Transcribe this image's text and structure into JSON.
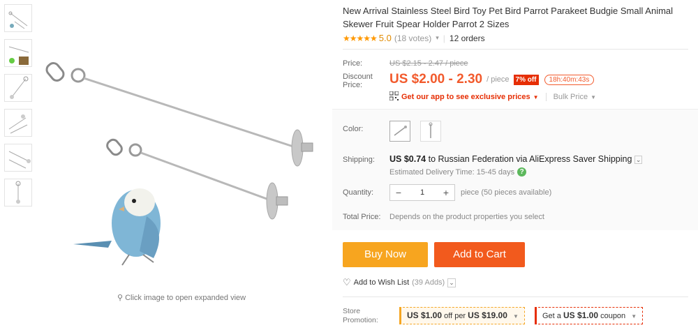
{
  "product": {
    "title": "New Arrival Stainless Steel Bird Toy Pet Bird Parrot Parakeet Budgie Small Animal Skewer Fruit Spear Holder Parrot 2 Sizes"
  },
  "rating": {
    "stars": "★★★★★",
    "score": "5.0",
    "votes": "(18 votes)",
    "orders": "12 orders"
  },
  "gallery": {
    "expand_text": "Click image to open expanded view"
  },
  "price": {
    "label": "Price:",
    "original": "US $2.15 - 2.47 / piece",
    "discount_label": "Discount Price:",
    "current": "US $2.00 - 2.30",
    "unit": "/ piece",
    "off_badge": "7% off",
    "timer": "18h:40m:43s",
    "app_text": "Get our app to see exclusive prices",
    "bulk": "Bulk Price"
  },
  "options": {
    "color_label": "Color:",
    "shipping_label": "Shipping:",
    "shipping_cost": "US $0.74",
    "shipping_text": "to Russian Federation via AliExpress Saver Shipping",
    "delivery": "Estimated Delivery Time: 15-45 days",
    "quantity_label": "Quantity:",
    "quantity_value": "1",
    "minus": "−",
    "plus": "+",
    "availability": "piece (50 pieces available)",
    "total_label": "Total Price:",
    "total_value": "Depends on the product properties you select"
  },
  "actions": {
    "buy_now": "Buy Now",
    "add_to_cart": "Add to Cart",
    "wishlist": "Add to Wish List",
    "wishlist_count": "(39 Adds)"
  },
  "promotion": {
    "label": "Store Promotion:",
    "coupon1_amount": "US $1.00",
    "coupon1_mid": "off per",
    "coupon1_threshold": "US $19.00",
    "coupon2_pre": "Get a",
    "coupon2_amount": "US $1.00",
    "coupon2_post": "coupon"
  },
  "colors": {
    "accent": "#f25a2c",
    "buy": "#f7a51f",
    "cart": "#f25a1d",
    "star": "#ff9800"
  }
}
